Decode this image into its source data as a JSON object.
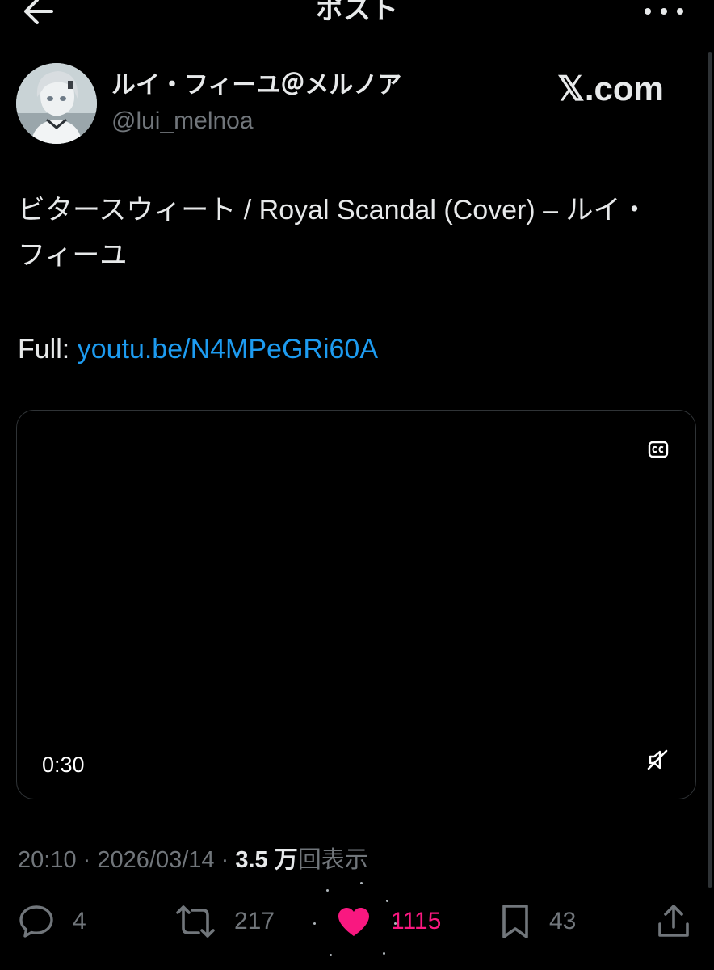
{
  "header": {
    "title": "ポスト",
    "back_icon": "arrow-left-icon",
    "more_icon": "more-horizontal-icon"
  },
  "author": {
    "display_name": "ルイ・フィーユ＠メルノア",
    "handle": "@lui_melnoa"
  },
  "watermark": "𝕏.com",
  "tweet": {
    "text": "ビタースウィート / Royal Scandal (Cover) – ルイ・フィーユ",
    "full_label": "Full: ",
    "link_text": "youtu.be/N4MPeGRi60A"
  },
  "video": {
    "duration": "0:30",
    "cc_icon": "closed-captions-icon",
    "mute_icon": "speaker-muted-icon"
  },
  "meta": {
    "time": "20:10",
    "separator": "·",
    "date": "2026/03/14",
    "views_count": "3.5 万",
    "views_label": "回表示"
  },
  "actions": {
    "reply_count": "4",
    "repost_count": "217",
    "like_count": "1115",
    "bookmark_count": "43"
  },
  "colors": {
    "background": "#000000",
    "text_primary": "#e7e9ea",
    "text_secondary": "#71767b",
    "link": "#1d9bf0",
    "like": "#f91880",
    "border": "#2f3336"
  }
}
